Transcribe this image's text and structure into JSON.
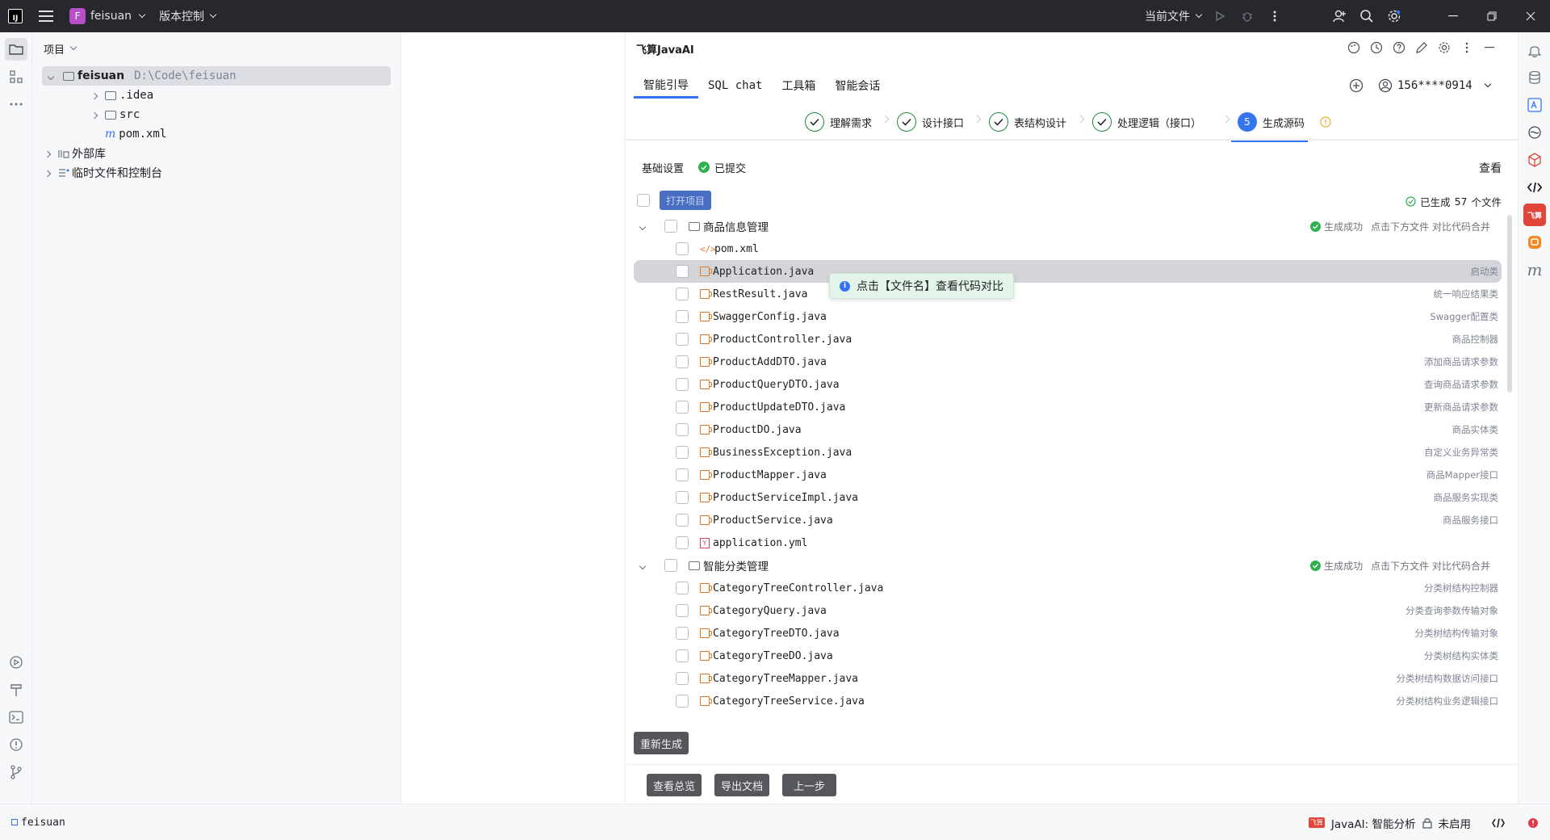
{
  "titlebar": {
    "project_badge": "F",
    "project_name": "feisuan",
    "vcs_label": "版本控制",
    "current_file_label": "当前文件"
  },
  "project_panel": {
    "header": "项目",
    "tree": [
      {
        "label": "feisuan",
        "path": "D:\\Code\\feisuan"
      },
      {
        "label": ".idea"
      },
      {
        "label": "src"
      },
      {
        "label": "pom.xml",
        "prefix": "m"
      },
      {
        "label": "外部库"
      },
      {
        "label": "临时文件和控制台"
      }
    ]
  },
  "plugin": {
    "title": "飞算JavaAI",
    "tabs": [
      "智能引导",
      "SQL chat",
      "工具箱",
      "智能会话"
    ],
    "active_tab": "智能引导",
    "user_id": "156****0914",
    "steps": [
      {
        "label": "理解需求",
        "state": "done"
      },
      {
        "label": "设计接口",
        "state": "done"
      },
      {
        "label": "表结构设计",
        "state": "done"
      },
      {
        "label": "处理逻辑（接口）",
        "state": "done"
      },
      {
        "label": "生成源码",
        "state": "active",
        "num": "5"
      }
    ],
    "basic_settings_label": "基础设置",
    "submitted_label": "已提交",
    "view_label": "查看",
    "open_project_button": "打开项目",
    "generated_prefix": "已生成",
    "generated_count": "57",
    "generated_suffix": "个文件",
    "groups": [
      {
        "name": "商品信息管理",
        "status": "生成成功",
        "hint": "点击下方文件  对比代码合并",
        "files": [
          {
            "name": "pom.xml",
            "type": "xml",
            "desc": ""
          },
          {
            "name": "Application.java",
            "type": "java",
            "desc": "启动类"
          },
          {
            "name": "RestResult.java",
            "type": "java",
            "desc": "统一响应结果类"
          },
          {
            "name": "SwaggerConfig.java",
            "type": "java",
            "desc": "Swagger配置类"
          },
          {
            "name": "ProductController.java",
            "type": "java",
            "desc": "商品控制器"
          },
          {
            "name": "ProductAddDTO.java",
            "type": "java",
            "desc": "添加商品请求参数"
          },
          {
            "name": "ProductQueryDTO.java",
            "type": "java",
            "desc": "查询商品请求参数"
          },
          {
            "name": "ProductUpdateDTO.java",
            "type": "java",
            "desc": "更新商品请求参数"
          },
          {
            "name": "ProductDO.java",
            "type": "java",
            "desc": "商品实体类"
          },
          {
            "name": "BusinessException.java",
            "type": "java",
            "desc": "自定义业务异常类"
          },
          {
            "name": "ProductMapper.java",
            "type": "java",
            "desc": "商品Mapper接口"
          },
          {
            "name": "ProductServiceImpl.java",
            "type": "java",
            "desc": "商品服务实现类"
          },
          {
            "name": "ProductService.java",
            "type": "java",
            "desc": "商品服务接口"
          },
          {
            "name": "application.yml",
            "type": "yml",
            "desc": ""
          }
        ]
      },
      {
        "name": "智能分类管理",
        "status": "生成成功",
        "hint": "点击下方文件  对比代码合并",
        "files": [
          {
            "name": "CategoryTreeController.java",
            "type": "java",
            "desc": "分类树结构控制器"
          },
          {
            "name": "CategoryQuery.java",
            "type": "java",
            "desc": "分类查询参数传输对象"
          },
          {
            "name": "CategoryTreeDTO.java",
            "type": "java",
            "desc": "分类树结构传输对象"
          },
          {
            "name": "CategoryTreeDO.java",
            "type": "java",
            "desc": "分类树结构实体类"
          },
          {
            "name": "CategoryTreeMapper.java",
            "type": "java",
            "desc": "分类树结构数据访问接口"
          },
          {
            "name": "CategoryTreeService.java",
            "type": "java",
            "desc": "分类树结构业务逻辑接口"
          }
        ]
      }
    ],
    "tooltip": "点击【文件名】查看代码对比",
    "regenerate_button": "重新生成",
    "bottom_buttons": [
      "查看总览",
      "导出文档",
      "上一步"
    ]
  },
  "statusbar": {
    "left_label": "feisuan",
    "badge": "飞算",
    "plugin_status": "JavaAI: 智能分析",
    "disabled_label": "未启用"
  },
  "colors": {
    "accent": "#3574f0",
    "success": "#2fb14f",
    "java_icon": "#e07a28",
    "titlebar_bg": "#27282e"
  }
}
